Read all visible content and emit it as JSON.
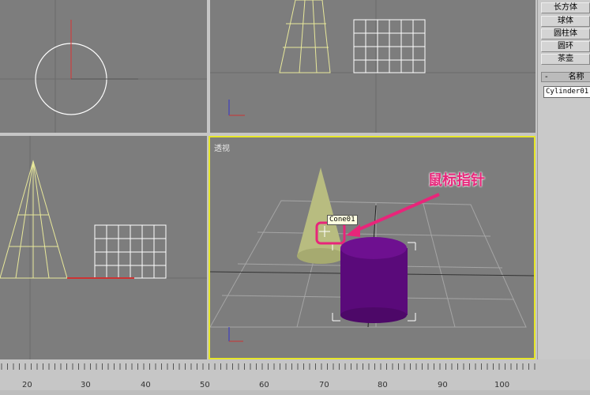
{
  "viewports": {
    "perspective_label": "透视"
  },
  "scene": {
    "tooltip": "Cone01",
    "annotation": "鼠标指针"
  },
  "panel": {
    "buttons": [
      "长方体",
      "球体",
      "圆柱体",
      "圆环",
      "茶壶"
    ],
    "rollout_label": "名称",
    "rollout_toggle": "-",
    "object_name": "Cylinder01"
  },
  "timeline": {
    "ticks": [
      "20",
      "30",
      "40",
      "50",
      "60",
      "70",
      "80",
      "90",
      "100"
    ]
  },
  "colors": {
    "viewport_bg": "#7d7d7d",
    "active_border": "#e6e629",
    "annotation": "#e8257a",
    "cylinder": "#5a0a7a",
    "cone": "#b8bc80"
  }
}
